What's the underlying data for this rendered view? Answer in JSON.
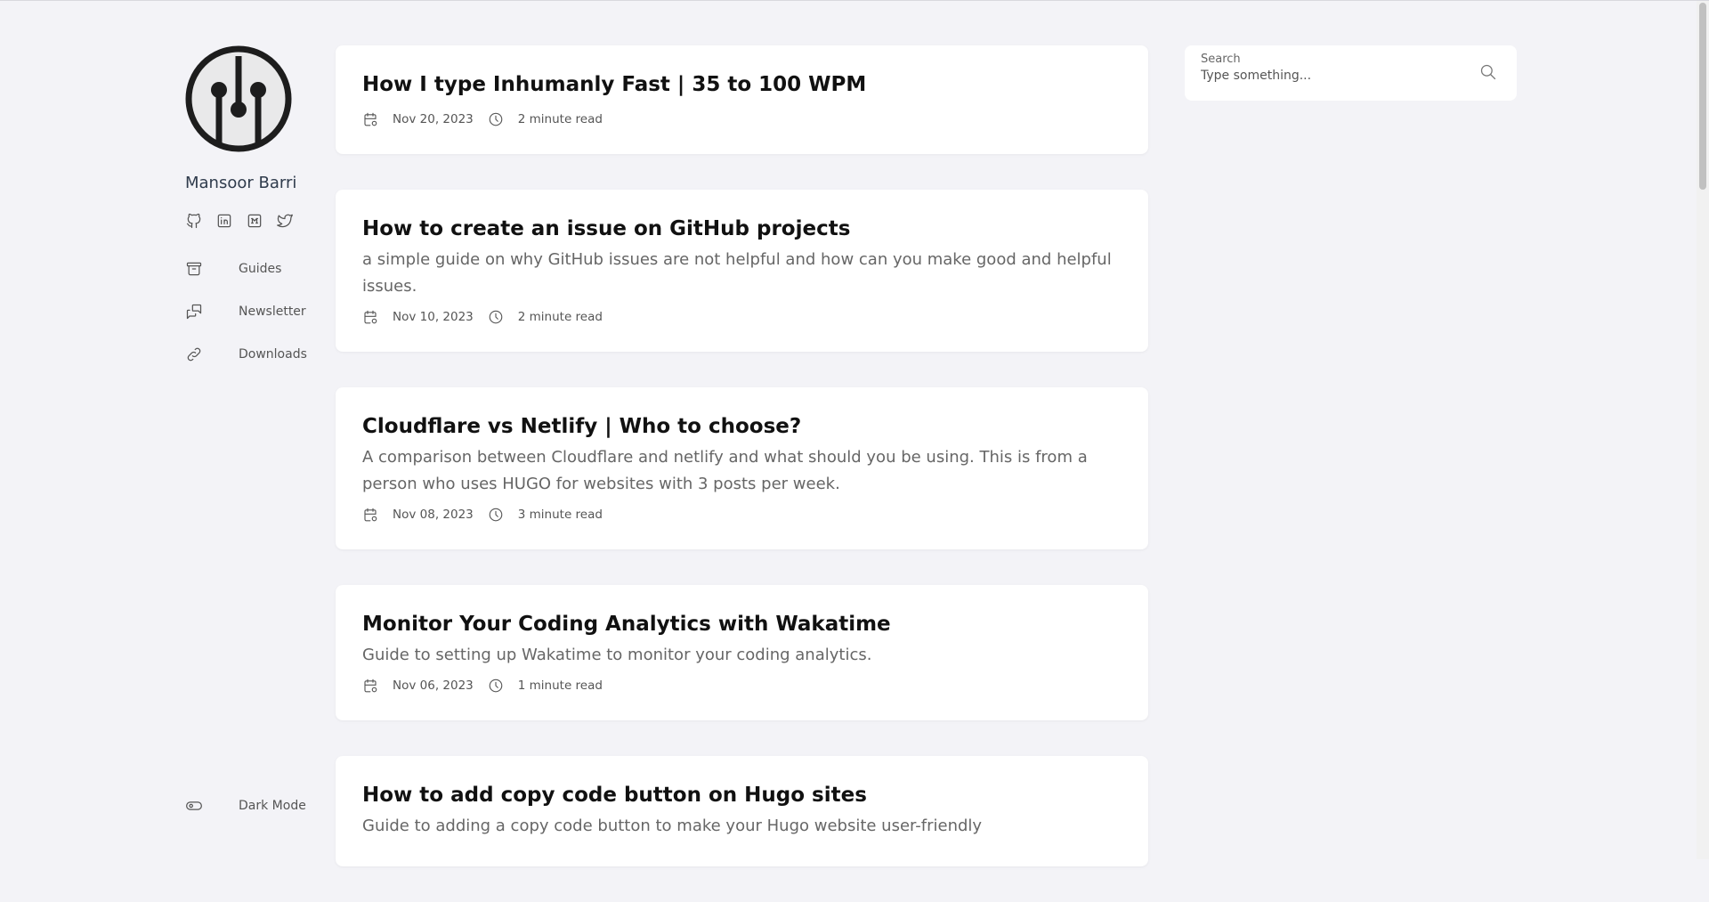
{
  "author": {
    "name": "Mansoor Barri"
  },
  "social": [
    "github-icon",
    "linkedin-icon",
    "medium-icon",
    "twitter-icon"
  ],
  "nav": [
    {
      "label": "Guides",
      "icon": "archive-icon"
    },
    {
      "label": "Newsletter",
      "icon": "chat-icon"
    },
    {
      "label": "Downloads",
      "icon": "link-icon"
    }
  ],
  "dark_mode": {
    "label": "Dark Mode"
  },
  "search": {
    "label": "Search",
    "placeholder": "Type something..."
  },
  "posts": [
    {
      "title": "How I type Inhumanly Fast | 35 to 100 WPM",
      "description": "",
      "date": "Nov 20, 2023",
      "read": "2 minute read"
    },
    {
      "title": "How to create an issue on GitHub projects",
      "description": "a simple guide on why GitHub issues are not helpful and how can you make good and helpful issues.",
      "date": "Nov 10, 2023",
      "read": "2 minute read"
    },
    {
      "title": "Cloudflare vs Netlify | Who to choose?",
      "description": "A comparison between Cloudflare and netlify and what should you be using. This is from a person who uses HUGO for websites with 3 posts per week.",
      "date": "Nov 08, 2023",
      "read": "3 minute read"
    },
    {
      "title": "Monitor Your Coding Analytics with Wakatime",
      "description": "Guide to setting up Wakatime to monitor your coding analytics.",
      "date": "Nov 06, 2023",
      "read": "1 minute read"
    },
    {
      "title": "How to add copy code button on Hugo sites",
      "description": "Guide to adding a copy code button to make your Hugo website user-friendly",
      "date": "",
      "read": ""
    }
  ]
}
